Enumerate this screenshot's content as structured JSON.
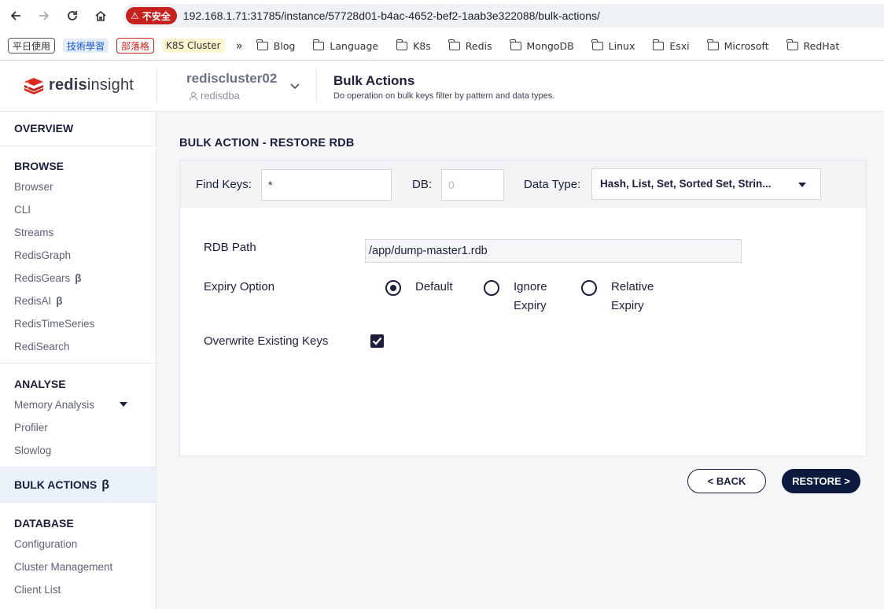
{
  "browser": {
    "security_label": "不安全",
    "url": "192.168.1.71:31785/instance/57728d01-b4ac-4652-bef2-1aab3e322088/bulk-actions/",
    "tag_chips": [
      "平日使用",
      "技術學習",
      "部落格",
      "K8S Cluster"
    ],
    "more_label": "»",
    "bookmarks": [
      "Blog",
      "Language",
      "K8s",
      "Redis",
      "MongoDB",
      "Linux",
      "Esxi",
      "Microsoft",
      "RedHat"
    ]
  },
  "header": {
    "logo_prefix": "redis",
    "logo_suffix": "insight",
    "db_name": "rediscluster02",
    "db_user": "redisdba",
    "page_title": "Bulk Actions",
    "page_subtitle": "Do operation on bulk keys filter by pattern and data types."
  },
  "sidebar": {
    "overview": "OVERVIEW",
    "browse_title": "BROWSE",
    "browse_items": [
      "Browser",
      "CLI",
      "Streams",
      "RedisGraph",
      "RedisGears",
      "RedisAI",
      "RedisTimeSeries",
      "RediSearch"
    ],
    "analyse_title": "ANALYSE",
    "analyse_items": [
      "Memory Analysis",
      "Profiler",
      "Slowlog"
    ],
    "bulk_actions": "BULK ACTIONS",
    "beta": "β",
    "database_title": "DATABASE",
    "database_items": [
      "Configuration",
      "Cluster Management",
      "Client List"
    ]
  },
  "main": {
    "section_title": "BULK ACTION - RESTORE RDB",
    "filter": {
      "find_keys_label": "Find Keys:",
      "find_keys_value": "*",
      "db_label": "DB:",
      "db_placeholder": "0",
      "data_type_label": "Data Type:",
      "data_type_value": "Hash, List, Set, Sorted Set, Strin..."
    },
    "form": {
      "rdb_path_label": "RDB Path",
      "rdb_path_value": "/app/dump-master1.rdb",
      "expiry_label": "Expiry Option",
      "expiry_options": [
        {
          "line1": "Default",
          "line2": "",
          "selected": true
        },
        {
          "line1": "Ignore",
          "line2": "Expiry",
          "selected": false
        },
        {
          "line1": "Relative",
          "line2": "Expiry",
          "selected": false
        }
      ],
      "overwrite_label": "Overwrite Existing Keys",
      "overwrite_checked": true
    },
    "buttons": {
      "back": "< BACK",
      "restore": "RESTORE >"
    }
  },
  "colors": {
    "primary_navy": "#0d1a3f",
    "insecure_red": "#c5221f",
    "redis_red": "#d82c20",
    "active_nav_bg": "#eaf1fb"
  }
}
